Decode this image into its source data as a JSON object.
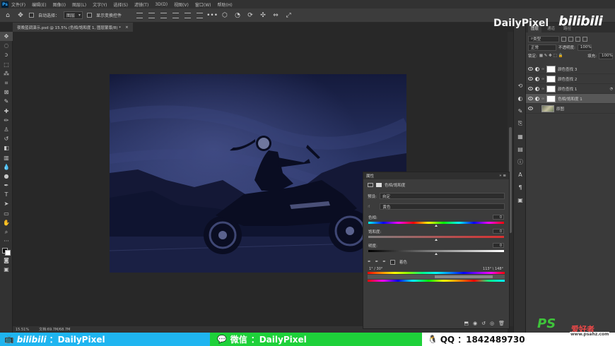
{
  "menubar": {
    "logo": "Ps",
    "items": [
      "文件(F)",
      "编辑(E)",
      "图像(I)",
      "图层(L)",
      "文字(Y)",
      "选择(S)",
      "滤镜(T)",
      "3D(D)",
      "视图(V)",
      "窗口(W)",
      "帮助(H)"
    ]
  },
  "options": {
    "auto_select_label": "自动选择：",
    "auto_select_value": "图层",
    "transform_label": "显示变换控件"
  },
  "document": {
    "tab_title": "夜晚蓝调演示.psd @ 15.5% (色相/饱和度 1, 图层蒙版/8) *",
    "zoom": "15.51%",
    "doc_info": "文档:69.7M/68.7M"
  },
  "layers_panel": {
    "tabs": [
      "图层",
      "通道",
      "路径"
    ],
    "filter_label": "类型",
    "blend_mode": "正常",
    "opacity_label": "不透明度:",
    "opacity_value": "100%",
    "lock_label": "锁定:",
    "fill_label": "填充:",
    "fill_value": "100%",
    "layers": [
      {
        "name": "颜色查找 3"
      },
      {
        "name": "颜色查找 2"
      },
      {
        "name": "颜色查找 1"
      },
      {
        "name": "色相/饱和度 1"
      },
      {
        "name": "原图"
      }
    ]
  },
  "properties": {
    "title": "属性",
    "adj_title": "色相/饱和度",
    "preset_label": "预设:",
    "preset_value": "自定",
    "channel_value": "黄色",
    "hue_label": "色相:",
    "hue_value": "0",
    "sat_label": "饱和度:",
    "sat_value": "0",
    "light_label": "明度:",
    "light_value": "0",
    "colorize_label": "着色",
    "range_left": "1° / 30°",
    "range_right": "113° \\ 148°"
  },
  "banner": {
    "bili_logo": "bilibili",
    "bili_text": "：DailyPixel",
    "wechat_label": "微信",
    "wechat_text": "：DailyPixel",
    "qq_label": "QQ",
    "qq_text": "：1842489730"
  },
  "watermarks": {
    "dailypixel": "DailyPixel",
    "bilibili": "bilibili",
    "ps_logo": "PS",
    "ps_text": "爱好者",
    "ps_url": "www.psahz.com"
  },
  "colors": {
    "bili_blue": "#1fb5f0",
    "wechat_green": "#1ed13a",
    "night_blue": "#1a2246"
  }
}
